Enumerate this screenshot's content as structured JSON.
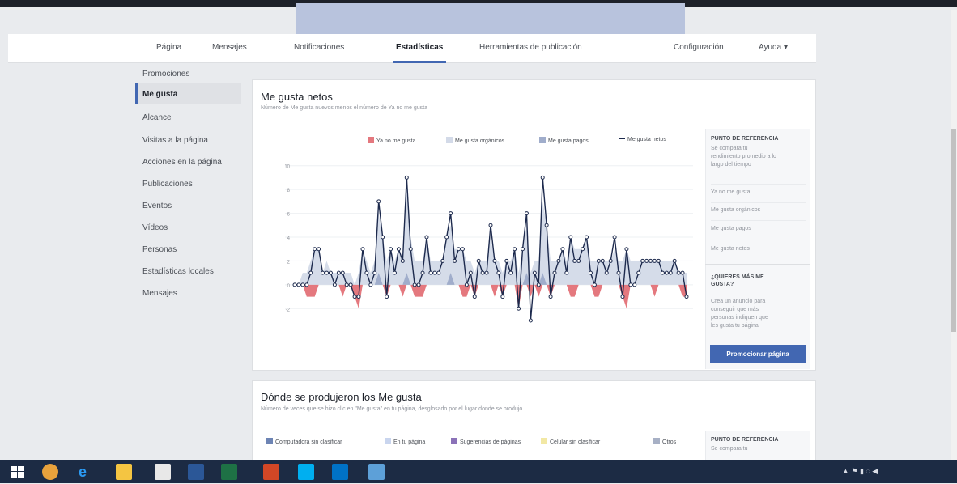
{
  "tabs": {
    "pagina": "Página",
    "mensajes": "Mensajes",
    "mensajes_badge": "",
    "notificaciones": "Notificaciones",
    "notificaciones_badge": "",
    "estadisticas": "Estadísticas",
    "herramientas": "Herramientas de publicación",
    "configuracion": "Configuración",
    "ayuda": "Ayuda ▾"
  },
  "sidebar": {
    "items": [
      "Promociones",
      "Me gusta",
      "Alcance",
      "Visitas a la página",
      "Acciones en la página",
      "Publicaciones",
      "Eventos",
      "Vídeos",
      "Personas",
      "Estadísticas locales",
      "Mensajes"
    ],
    "active_index": 1
  },
  "card1": {
    "title": "Me gusta netos",
    "subtitle": "Número de Me gusta nuevos menos el número de Ya no me gusta"
  },
  "chart_data": {
    "type": "line",
    "legend": [
      "Ya no me gusta",
      "Me gusta orgánicos",
      "Me gusta pagos",
      "Me gusta netos"
    ],
    "colors": {
      "unlikes": "#e4787e",
      "organic": "#d3dae8",
      "paid": "#a0adcb",
      "net": "#1d2a4d"
    },
    "y_ticks": [
      "10",
      "8",
      "6",
      "4",
      "2",
      "0",
      "-2"
    ],
    "ylim": [
      -3,
      11
    ],
    "x_ticks": [
      "",
      "",
      "",
      "",
      "",
      "",
      "",
      "",
      "",
      "",
      "",
      "",
      "",
      "",
      "",
      "",
      ""
    ],
    "x_sublabels": [
      "",
      "",
      ""
    ],
    "net": [
      0,
      0,
      0,
      0,
      1,
      3,
      3,
      1,
      1,
      1,
      0,
      1,
      1,
      0,
      0,
      -1,
      -1,
      3,
      1,
      0,
      1,
      7,
      4,
      -1,
      3,
      1,
      3,
      2,
      9,
      3,
      0,
      0,
      1,
      4,
      1,
      1,
      1,
      2,
      4,
      6,
      2,
      3,
      3,
      0,
      1,
      -1,
      2,
      1,
      1,
      5,
      2,
      1,
      -1,
      2,
      1,
      3,
      -2,
      3,
      6,
      -3,
      1,
      0,
      9,
      5,
      -1,
      1,
      2,
      3,
      1,
      4,
      2,
      2,
      3,
      4,
      1,
      0,
      2,
      2,
      1,
      2,
      4,
      1,
      -1,
      3,
      0,
      0,
      1,
      2,
      2,
      2,
      2,
      2,
      1,
      1,
      1,
      2,
      1,
      1,
      -1
    ],
    "unlikes": [
      0,
      0,
      0,
      -1,
      -1,
      -1,
      0,
      0,
      0,
      0,
      0,
      0,
      -1,
      0,
      0,
      -1,
      -2,
      0,
      0,
      0,
      0,
      0,
      0,
      -1,
      0,
      0,
      0,
      -1,
      0,
      0,
      -1,
      -1,
      -1,
      0,
      0,
      0,
      0,
      0,
      0,
      0,
      0,
      0,
      -1,
      -1,
      0,
      -1,
      0,
      0,
      0,
      0,
      -1,
      0,
      -1,
      0,
      0,
      0,
      -2,
      0,
      0,
      -1,
      0,
      -1,
      0,
      0,
      -1,
      0,
      0,
      0,
      0,
      -1,
      -1,
      0,
      0,
      0,
      0,
      -1,
      -1,
      0,
      0,
      0,
      0,
      0,
      -1,
      -2,
      0,
      0,
      0,
      0,
      0,
      0,
      -1,
      0,
      0,
      0,
      0,
      0,
      0,
      -1,
      -1
    ],
    "organic": [
      0,
      0,
      1,
      1,
      2,
      3,
      3,
      1,
      2,
      1,
      1,
      1,
      1,
      1,
      1,
      0,
      1,
      3,
      2,
      1,
      2,
      6,
      4,
      2,
      3,
      2,
      3,
      2,
      8,
      4,
      2,
      2,
      2,
      4,
      2,
      2,
      2,
      2,
      4,
      5,
      3,
      3,
      3,
      2,
      2,
      1,
      2,
      2,
      2,
      4,
      2,
      2,
      1,
      2,
      2,
      3,
      1,
      3,
      5,
      1,
      2,
      2,
      7,
      5,
      2,
      2,
      2,
      3,
      2,
      4,
      3,
      3,
      3,
      4,
      2,
      2,
      2,
      2,
      2,
      2,
      3,
      2,
      2,
      3,
      2,
      2,
      2,
      2,
      2,
      2,
      2,
      2,
      2,
      2,
      2,
      2,
      1,
      1,
      1
    ],
    "paid": [
      0,
      0,
      0,
      0,
      0,
      0,
      0,
      0,
      0,
      0,
      0,
      0,
      0,
      0,
      0,
      0,
      0,
      0,
      0,
      0,
      0,
      1,
      0,
      0,
      0,
      0,
      0,
      0,
      1,
      0,
      0,
      0,
      0,
      0,
      0,
      0,
      0,
      0,
      0,
      1,
      0,
      0,
      0,
      0,
      0,
      0,
      0,
      0,
      0,
      0,
      0,
      0,
      0,
      0,
      0,
      0,
      0,
      0,
      1,
      0,
      0,
      0,
      1,
      0,
      0,
      0,
      0,
      0,
      0,
      0,
      0,
      0,
      0,
      0,
      0,
      0,
      0,
      0,
      0,
      0,
      0,
      0,
      0,
      0,
      0,
      0,
      0,
      0,
      0,
      0,
      0,
      0,
      0,
      0,
      0,
      0,
      0,
      0,
      0
    ]
  },
  "bench1": {
    "heading": "PUNTO DE REFERENCIA",
    "desc": [
      "Se compara tu",
      "rendimiento promedio a lo",
      "largo del tiempo"
    ],
    "items": [
      "Ya no me gusta",
      "Me gusta orgánicos",
      "Me gusta pagos",
      "Me gusta netos"
    ]
  },
  "promo": {
    "heading": [
      "¿QUIERES MÁS ME",
      "GUSTA?"
    ],
    "desc": [
      "Crea un anuncio para",
      "conseguir que más",
      "personas indiquen que",
      "les gusta tu página"
    ],
    "button": "Promocionar página"
  },
  "card2": {
    "title": "Dónde se produjeron los Me gusta",
    "subtitle": "Número de veces que se hizo clic en \"Me gusta\" en tu página, desglosado por el lugar donde se produjo",
    "legend": [
      "Computadora sin clasificar",
      "En tu página",
      "Sugerencias de páginas",
      "Celular sin clasificar",
      "Otros"
    ],
    "legend_colors": [
      "#6d84b4",
      "#c9d5ee",
      "#8b72b8",
      "#f2e8a4",
      "#a7b0c5"
    ],
    "bench_heading": "PUNTO DE REFERENCIA",
    "bench_desc": "Se compara tu"
  },
  "taskbar": {
    "clock_time": "",
    "clock_date": ""
  }
}
